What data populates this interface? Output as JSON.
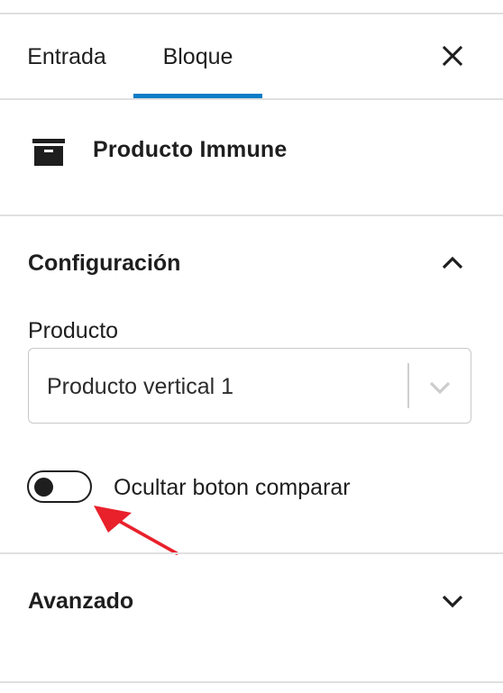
{
  "tabs": {
    "entrada": "Entrada",
    "bloque": "Bloque",
    "active": "Bloque",
    "accent_color": "#0a7cc5"
  },
  "close": {
    "icon": "close-icon"
  },
  "block": {
    "icon": "archive-box-icon",
    "title": "Producto Immune"
  },
  "configuracion": {
    "title": "Configuración",
    "expanded": true,
    "icon": "chevron-up-icon",
    "producto_label": "Producto",
    "producto_value": "Producto vertical 1",
    "select_icon": "chevron-down-icon",
    "toggle_label": "Ocultar boton comparar",
    "toggle_on": false
  },
  "avanzado": {
    "title": "Avanzado",
    "expanded": false,
    "icon": "chevron-down-icon"
  },
  "annotation": {
    "icon": "red-arrow-annotation",
    "color": "#e8212b"
  }
}
